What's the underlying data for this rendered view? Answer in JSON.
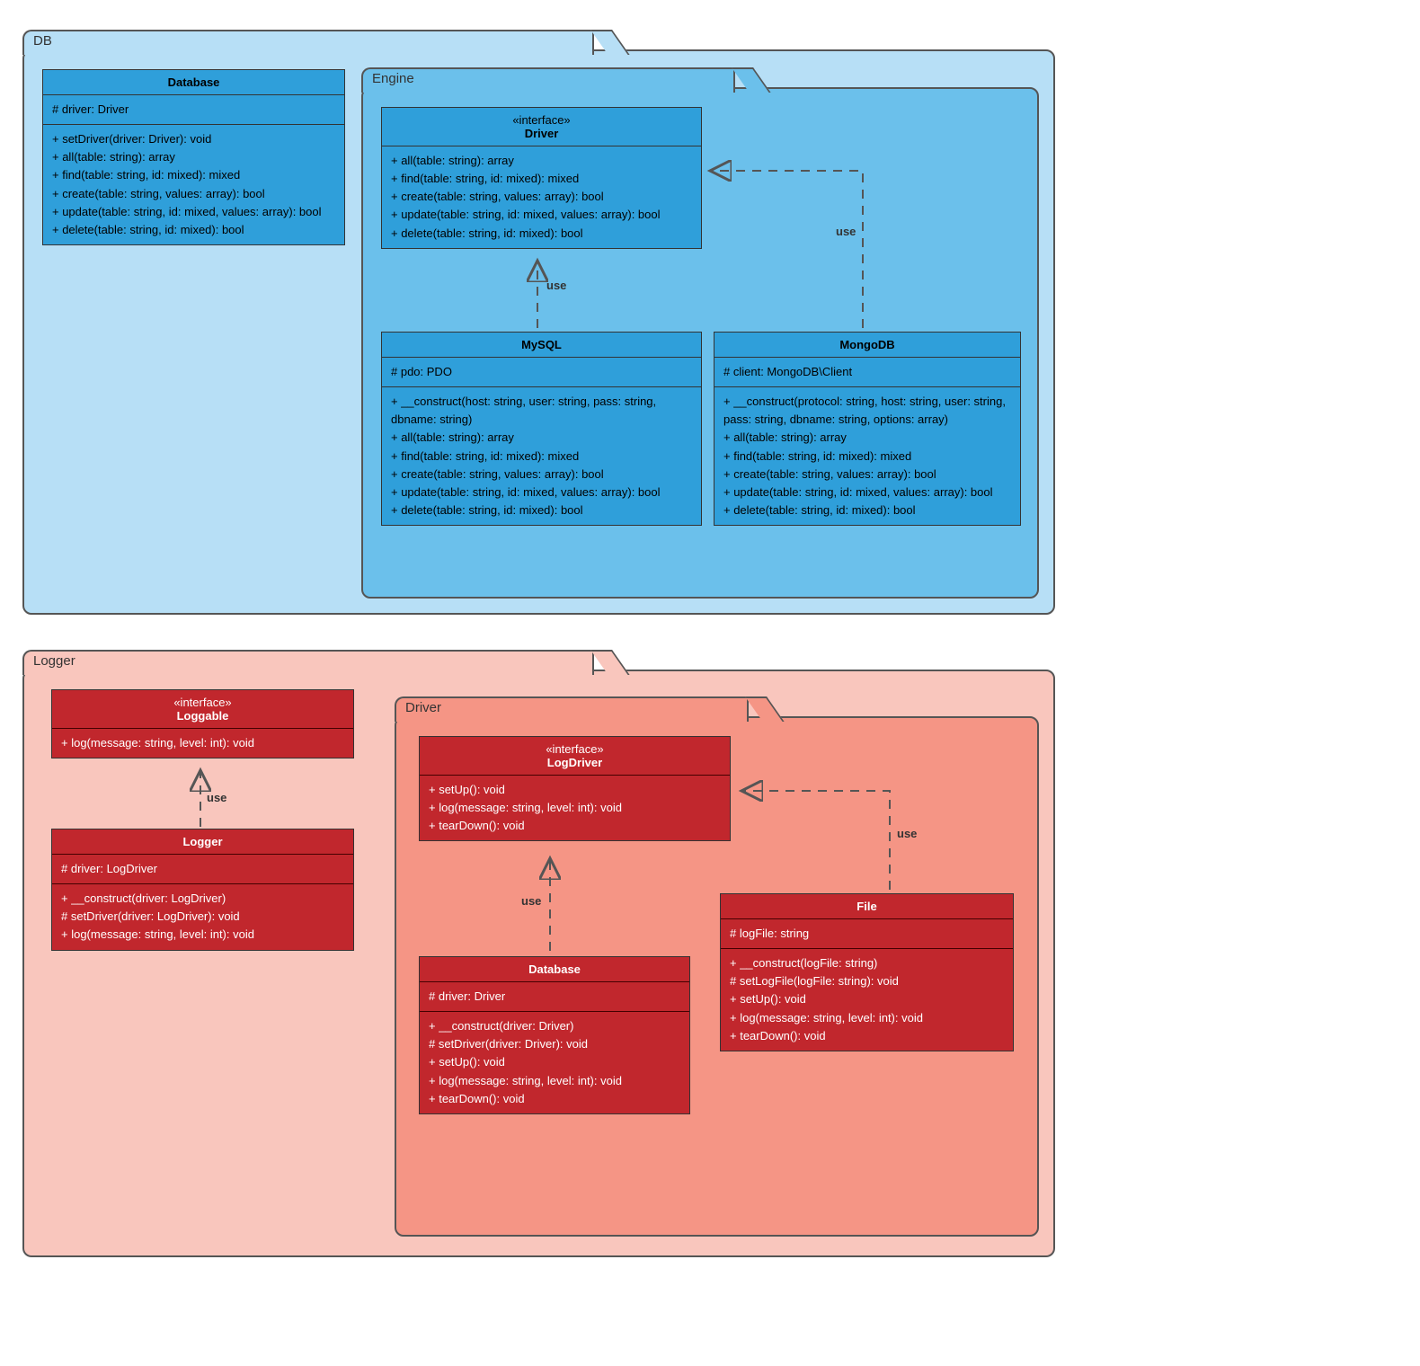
{
  "db": {
    "name": "DB",
    "engine": "Engine",
    "database": {
      "title": "Database",
      "attr": "# driver: Driver",
      "ops": "+ setDriver(driver: Driver): void\n+ all(table: string): array\n+ find(table: string, id: mixed): mixed\n+ create(table: string, values: array): bool\n+ update(table: string, id: mixed, values: array): bool\n+ delete(table: string, id: mixed): bool"
    },
    "driver": {
      "stereo": "«interface»",
      "title": "Driver",
      "ops": "+ all(table: string): array\n+ find(table: string, id: mixed): mixed\n+ create(table: string, values: array): bool\n+ update(table: string, id: mixed, values: array): bool\n+ delete(table: string, id: mixed): bool"
    },
    "mysql": {
      "title": "MySQL",
      "attr": "# pdo: PDO",
      "ops": "+ __construct(host: string, user: string, pass: string, dbname: string)\n+ all(table: string): array\n+ find(table: string, id: mixed): mixed\n+ create(table: string, values: array): bool\n+ update(table: string, id: mixed, values: array): bool\n+ delete(table: string, id: mixed): bool"
    },
    "mongo": {
      "title": "MongoDB",
      "attr": "# client: MongoDB\\Client",
      "ops": "+ __construct(protocol: string, host: string, user: string, pass: string, dbname: string, options: array)\n+ all(table: string): array\n+ find(table: string, id: mixed): mixed\n+ create(table: string, values: array): bool\n+ update(table: string, id: mixed, values: array): bool\n+ delete(table: string, id: mixed): bool"
    }
  },
  "logger": {
    "name": "Logger",
    "driver_pkg": "Driver",
    "loggable": {
      "stereo": "«interface»",
      "title": "Loggable",
      "ops": "+ log(message: string, level: int): void"
    },
    "logger": {
      "title": "Logger",
      "attr": "# driver: LogDriver",
      "ops": "+ __construct(driver: LogDriver)\n# setDriver(driver: LogDriver): void\n+ log(message: string, level: int): void"
    },
    "logdriver": {
      "stereo": "«interface»",
      "title": "LogDriver",
      "ops": "+ setUp(): void\n+ log(message: string, level: int): void\n+ tearDown(): void"
    },
    "database": {
      "title": "Database",
      "attr": "# driver: Driver",
      "ops": "+ __construct(driver: Driver)\n# setDriver(driver: Driver): void\n+ setUp(): void\n+ log(message: string, level: int): void\n+ tearDown(): void"
    },
    "file": {
      "title": "File",
      "attr": "# logFile: string",
      "ops": "+ __construct(logFile: string)\n# setLogFile(logFile: string): void\n+ setUp(): void\n+ log(message: string, level: int): void\n+ tearDown(): void"
    }
  },
  "use": "use"
}
